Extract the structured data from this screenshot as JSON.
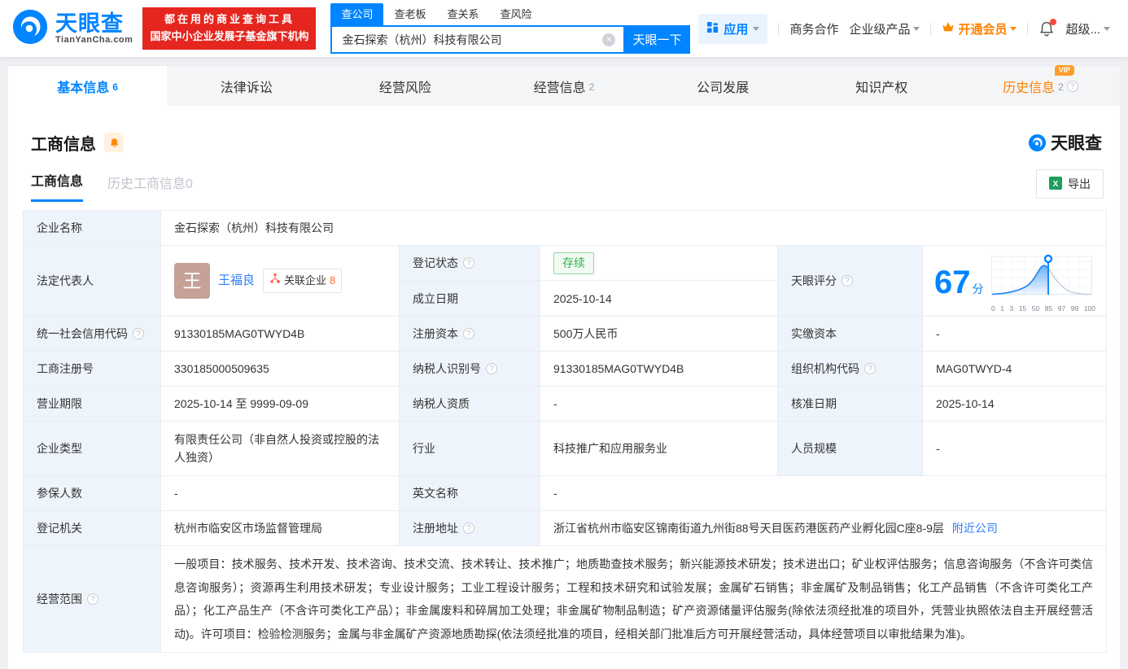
{
  "header": {
    "logo": {
      "title": "天眼查",
      "domain": "TianYanCha.com"
    },
    "promo": {
      "line1": "都在用的商业查询工具",
      "line2": "国家中小企业发展子基金旗下机构"
    },
    "search": {
      "tabs": [
        {
          "label": "查公司"
        },
        {
          "label": "查老板"
        },
        {
          "label": "查关系"
        },
        {
          "label": "查风险"
        }
      ],
      "value": "金石探索（杭州）科技有限公司",
      "button": "天眼一下"
    },
    "nav": {
      "apps": "应用",
      "cooperation": "商务合作",
      "enterprise": "企业级产品",
      "vip": "开通会员",
      "super": "超级..."
    }
  },
  "page_tabs": [
    {
      "label": "基本信息",
      "count": "6"
    },
    {
      "label": "法律诉讼",
      "count": ""
    },
    {
      "label": "经营风险",
      "count": ""
    },
    {
      "label": "经营信息",
      "count": "2"
    },
    {
      "label": "公司发展",
      "count": ""
    },
    {
      "label": "知识产权",
      "count": ""
    },
    {
      "label": "历史信息",
      "count": "2",
      "badge": "VIP"
    }
  ],
  "section": {
    "title": "工商信息",
    "watermark": "天眼查",
    "subtabs": {
      "active": "工商信息",
      "inactive": "历史工商信息0"
    },
    "export_label": "导出"
  },
  "business": {
    "company_name": {
      "label": "企业名称",
      "value": "金石探索（杭州）科技有限公司"
    },
    "legal_rep": {
      "label": "法定代表人",
      "avatar_char": "王",
      "name": "王福良",
      "related_label": "关联企业",
      "related_count": "8"
    },
    "reg_status": {
      "label": "登记状态",
      "value": "存续"
    },
    "establish_date": {
      "label": "成立日期",
      "value": "2025-10-14"
    },
    "score": {
      "label": "天眼评分"
    },
    "credit_code": {
      "label": "统一社会信用代码",
      "value": "91330185MAG0TWYD4B"
    },
    "reg_capital": {
      "label": "注册资本",
      "value": "500万人民币"
    },
    "paid_capital": {
      "label": "实缴资本",
      "value": "-"
    },
    "reg_number": {
      "label": "工商注册号",
      "value": "330185000509635"
    },
    "taxpayer_id": {
      "label": "纳税人识别号",
      "value": "91330185MAG0TWYD4B"
    },
    "org_code": {
      "label": "组织机构代码",
      "value": "MAG0TWYD-4"
    },
    "business_term": {
      "label": "营业期限",
      "value": "2025-10-14 至 9999-09-09"
    },
    "taxpayer_quality": {
      "label": "纳税人资质",
      "value": "-"
    },
    "approval_date": {
      "label": "核准日期",
      "value": "2025-10-14"
    },
    "company_type": {
      "label": "企业类型",
      "value": "有限责任公司（非自然人投资或控股的法人独资）"
    },
    "industry": {
      "label": "行业",
      "value": "科技推广和应用服务业"
    },
    "staff_size": {
      "label": "人员规模",
      "value": "-"
    },
    "insured_count": {
      "label": "参保人数",
      "value": "-"
    },
    "english_name": {
      "label": "英文名称",
      "value": "-"
    },
    "reg_authority": {
      "label": "登记机关",
      "value": "杭州市临安区市场监督管理局"
    },
    "reg_address": {
      "label": "注册地址",
      "value": "浙江省杭州市临安区锦南街道九州街88号天目医药港医药产业孵化园C座8-9层",
      "nearby_link": "附近公司"
    },
    "business_scope": {
      "label": "经营范围",
      "value": "一般项目：技术服务、技术开发、技术咨询、技术交流、技术转让、技术推广；地质勘查技术服务；新兴能源技术研发；技术进出口；矿业权评估服务；信息咨询服务（不含许可类信息咨询服务）；资源再生利用技术研发；专业设计服务；工业工程设计服务；工程和技术研究和试验发展；金属矿石销售；非金属矿及制品销售；化工产品销售（不含许可类化工产品）；化工产品生产（不含许可类化工产品）；非金属废料和碎屑加工处理；非金属矿物制品制造；矿产资源储量评估服务(除依法须经批准的项目外，凭营业执照依法自主开展经营活动)。许可项目：检验检测服务；金属与非金属矿产资源地质勘探(依法须经批准的项目，经相关部门批准后方可开展经营活动，具体经营项目以审批结果为准)。"
    }
  },
  "chart_data": {
    "type": "area",
    "title": "天眼评分",
    "score": 67,
    "score_unit": "分",
    "x_ticks": [
      "0",
      "1",
      "3",
      "15",
      "50",
      "85",
      "97",
      "99",
      "100"
    ],
    "marker_value": 67,
    "description": "bell-shaped score distribution curve, area filled blue to the left of the marker pinned at score 67",
    "accent_color": "#0084ff"
  },
  "colors": {
    "brand_blue": "#0084ff",
    "link_blue": "#2f7df6",
    "vip_orange": "#ff8000",
    "promo_red": "#e5261f",
    "status_green": "#31b24c",
    "label_bg": "#eef4fb"
  }
}
